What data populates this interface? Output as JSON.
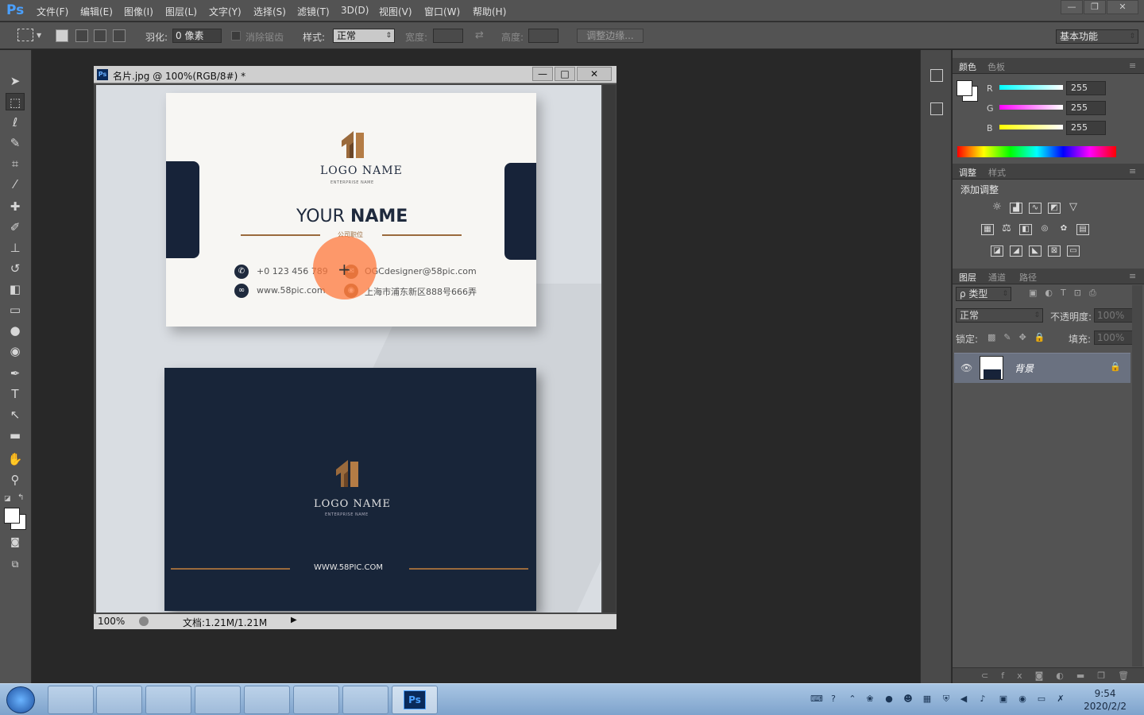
{
  "app": {
    "logo": "Ps",
    "menu": [
      "文件(F)",
      "编辑(E)",
      "图像(I)",
      "图层(L)",
      "文字(Y)",
      "选择(S)",
      "滤镜(T)",
      "3D(D)",
      "视图(V)",
      "窗口(W)",
      "帮助(H)"
    ],
    "window_controls": [
      "—",
      "❐",
      "✕"
    ]
  },
  "options": {
    "feather_label": "羽化:",
    "feather_value": "0 像素",
    "antialias_label": "消除锯齿",
    "style_label": "样式:",
    "style_value": "正常",
    "width_label": "宽度:",
    "height_label": "高度:",
    "refine_edge": "调整边缘...",
    "workspace": "基本功能"
  },
  "document": {
    "title": "名片.jpg @ 100%(RGB/8#) *",
    "zoom": "100%",
    "doc_size": "文档:1.21M/1.21M",
    "buttons": [
      "—",
      "□",
      "✕"
    ]
  },
  "card_front": {
    "logo_name": "LOGO NAME",
    "enterprise": "ENTERPRISE NAME",
    "your": "YOUR",
    "name": "NAME",
    "position": "公司职位",
    "phone": "+0 123 456 789",
    "email": "OGCdesigner@58pic.com",
    "web": "www.58pic.com",
    "address": "上海市浦东新区888号666弄"
  },
  "card_back": {
    "logo_name": "LOGO NAME",
    "enterprise": "ENTERPRISE NAME",
    "website": "WWW.58PIC.COM"
  },
  "color_panel": {
    "tabs": [
      "颜色",
      "色板"
    ],
    "channels": [
      {
        "label": "R",
        "value": "255"
      },
      {
        "label": "G",
        "value": "255"
      },
      {
        "label": "B",
        "value": "255"
      }
    ]
  },
  "adjust_panel": {
    "tabs": [
      "调整",
      "样式"
    ],
    "heading": "添加调整"
  },
  "layers_panel": {
    "tabs": [
      "图层",
      "通道",
      "路径"
    ],
    "filter_kind": "ρ 类型",
    "blend_mode": "正常",
    "opacity_label": "不透明度:",
    "opacity_value": "100%",
    "lock_label": "锁定:",
    "fill_label": "填充:",
    "fill_value": "100%",
    "layer_name": "背景"
  },
  "taskbar": {
    "time": "9:54",
    "date": "2020/2/2"
  },
  "colors": {
    "navy": "#172339",
    "gold": "#9a6a3c",
    "orange_cursor": "#ff7a3c",
    "ps_blue": "#4aa0ff"
  }
}
